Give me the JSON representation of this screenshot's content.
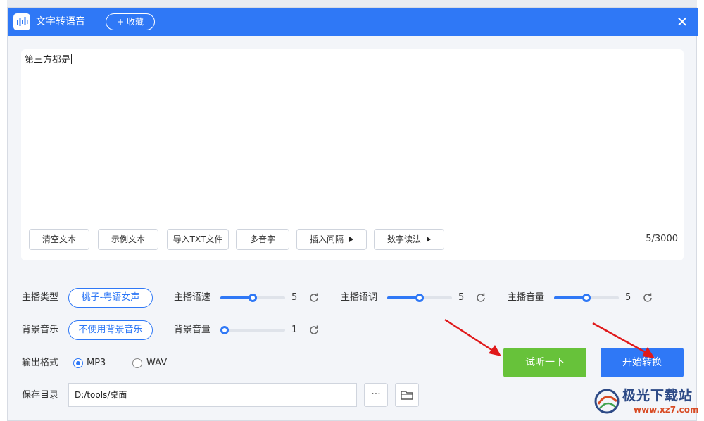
{
  "window": {
    "title": "文字转语音",
    "collect_label": "+ 收藏",
    "close_glyph": "✕"
  },
  "editor": {
    "text": "第三方都是",
    "char_count": "5/3000",
    "buttons": {
      "clear": "清空文本",
      "sample": "示例文本",
      "import_txt": "导入TXT文件",
      "polyphone": "多音字",
      "insert_pause": "插入间隔",
      "number_reading": "数字读法"
    }
  },
  "settings": {
    "anchor_type": {
      "label": "主播类型",
      "value": "桃子-粤语女声"
    },
    "speed": {
      "label": "主播语速",
      "value": "5",
      "level": 0.5
    },
    "pitch": {
      "label": "主播语调",
      "value": "5",
      "level": 0.5
    },
    "volume": {
      "label": "主播音量",
      "value": "5",
      "level": 0.5
    },
    "bg_music": {
      "label": "背景音乐",
      "value": "不使用背景音乐"
    },
    "bg_volume": {
      "label": "背景音量",
      "value": "1",
      "level": 0.0
    },
    "format": {
      "label": "输出格式",
      "options": [
        "MP3",
        "WAV"
      ],
      "selected": "MP3"
    },
    "save_dir": {
      "label": "保存目录",
      "path": "D:/tools/桌面",
      "more_glyph": "···"
    }
  },
  "actions": {
    "preview": "试听一下",
    "start": "开始转换"
  },
  "watermark": {
    "name": "极光下载站",
    "url": "www.xz7.com"
  },
  "colors": {
    "primary": "#2f78f6",
    "preview_green": "#67c23a",
    "arrow_red": "#e0191b"
  }
}
